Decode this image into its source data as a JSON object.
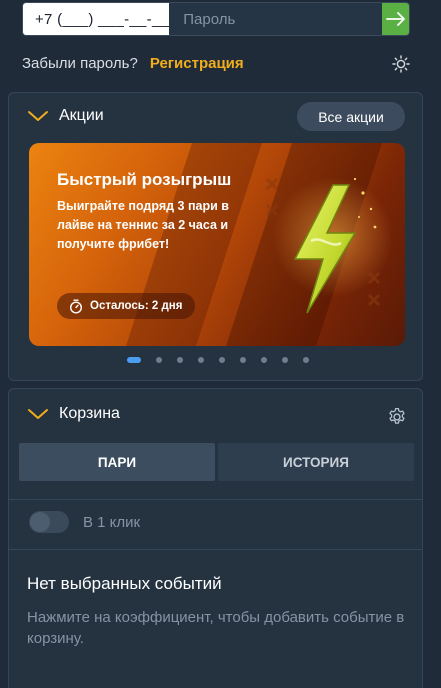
{
  "login": {
    "phone_value": "+7 (___) ___-__-__",
    "password_placeholder": "Пароль",
    "submit_icon": "arrow-right-icon",
    "forgot_password": "Забыли пароль?",
    "register": "Регистрация",
    "theme_icon": "sun-icon"
  },
  "promotions": {
    "title": "Акции",
    "all_button": "Все акции",
    "card": {
      "title": "Быстрый розыгрыш",
      "description": "Выиграйте подряд 3 пари в лайве на теннис за 2 часа и получите фрибет!",
      "timer_text": "Осталось: 2 дня",
      "timer_icon": "stopwatch-icon",
      "art_icon": "lightning-tennis-ball-icon"
    },
    "carousel": {
      "total": 9,
      "active_index": 0
    }
  },
  "cart": {
    "title": "Корзина",
    "settings_icon": "gear-icon",
    "tabs": [
      {
        "label": "ПАРИ",
        "active": true
      },
      {
        "label": "ИСТОРИЯ",
        "active": false
      }
    ],
    "one_click": {
      "label": "В 1 клик",
      "enabled": false
    },
    "empty_title": "Нет выбранных событий",
    "empty_hint": "Нажмите на коэффициент, чтобы добавить событие в корзину."
  },
  "colors": {
    "background": "#1f2b38",
    "panel": "#253341",
    "accent_yellow": "#f2ad1c",
    "submit_green": "#5bb043",
    "dot_active": "#4a9ef0",
    "promo_orange": "#e67a0f"
  }
}
